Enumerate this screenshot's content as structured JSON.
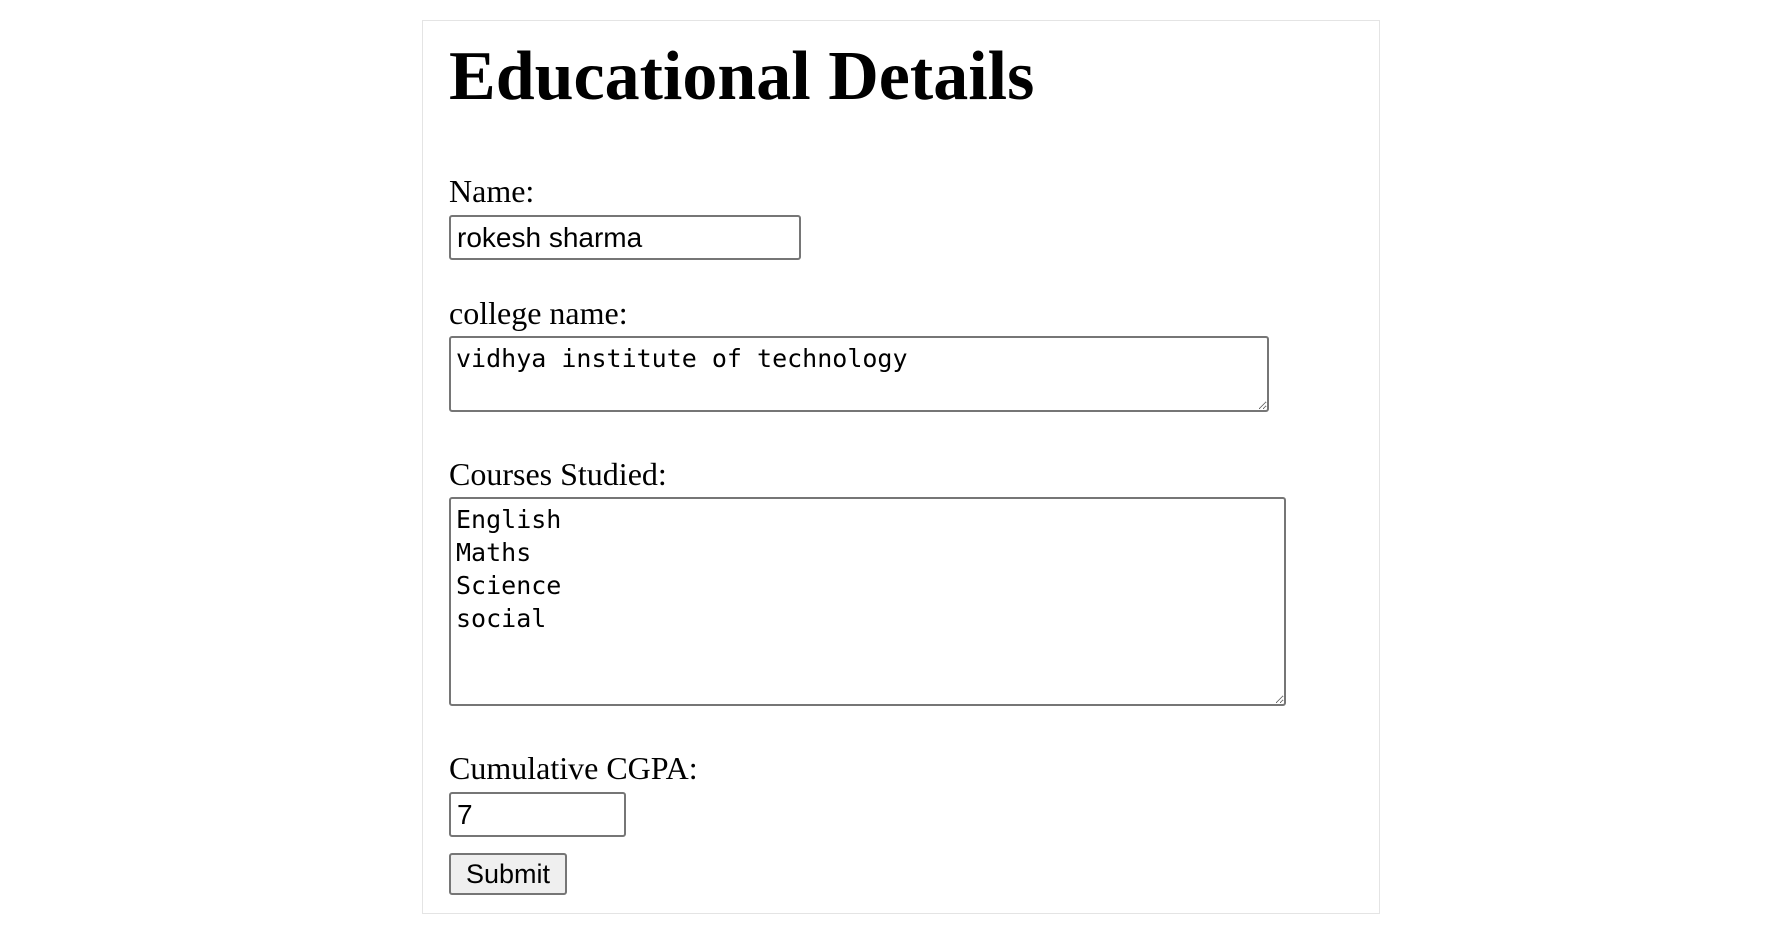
{
  "form": {
    "title": "Educational Details",
    "name_label": "Name:",
    "name_value": "rokesh sharma",
    "college_label": "college name:",
    "college_value": "vidhya institute of technology",
    "courses_label": "Courses Studied:",
    "courses_value": "English\nMaths\nScience\nsocial",
    "cgpa_label": "Cumulative CGPA:",
    "cgpa_value": "7",
    "submit_label": "Submit"
  }
}
